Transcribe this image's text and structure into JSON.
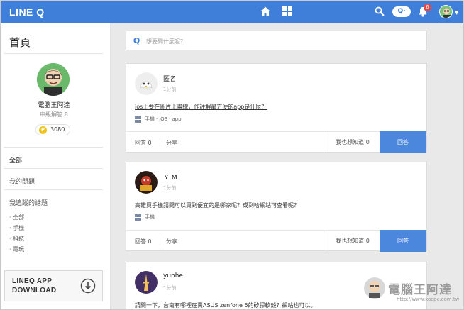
{
  "topbar": {
    "logo": "LINE Q",
    "q_pill": "Q·",
    "notification_count": "6"
  },
  "sidebar": {
    "title": "首頁",
    "profile": {
      "name": "電腦王阿達",
      "rank": "中級解答 8",
      "coins": "3080",
      "coin_symbol": "P"
    },
    "menu": {
      "all": "全部",
      "my_questions": "我的問題",
      "followed_topics": "我追蹤的話題"
    },
    "topics": [
      "全部",
      "手機",
      "科技",
      "電玩"
    ],
    "download": {
      "line1": "LINEQ APP",
      "line2": "DOWNLOAD"
    }
  },
  "feed": {
    "ask_placeholder": "想要問什麼呢？",
    "ask_icon_letter": "Q",
    "posts": [
      {
        "author": "匿名",
        "time": "1分前",
        "question": "ios上要在圖片上畫線，作註解最方便的app是什麼？",
        "tags": [
          "手機",
          "iOS",
          "app"
        ],
        "answers": "回答 0",
        "share": "分享",
        "metoo": "我也想知道 0",
        "reply": "回答"
      },
      {
        "author": "Ｙ M",
        "time": "1分前",
        "question": "高雄買手機請問可以買到便宜的是哪家呢？或到哈網站可查看呢？",
        "tags": [
          "手機"
        ],
        "answers": "回答 0",
        "share": "分享",
        "metoo": "我也想知道 0",
        "reply": "回答"
      },
      {
        "author": "yunhe",
        "time": "1分前",
        "question": "請問一下，台南有哪裡在賣ASUS zenfone 5的矽膠軟殼？網站也可以。",
        "tags": [],
        "answers": "",
        "share": "",
        "metoo": "",
        "reply": ""
      }
    ]
  },
  "watermark": {
    "text": "電腦王阿達",
    "url": "http://www.kocpc.com.tw"
  },
  "colors": {
    "brand": "#3f7fd9",
    "reply_button": "#4a87dd",
    "coin": "#f0c419",
    "badge": "#e44646"
  }
}
